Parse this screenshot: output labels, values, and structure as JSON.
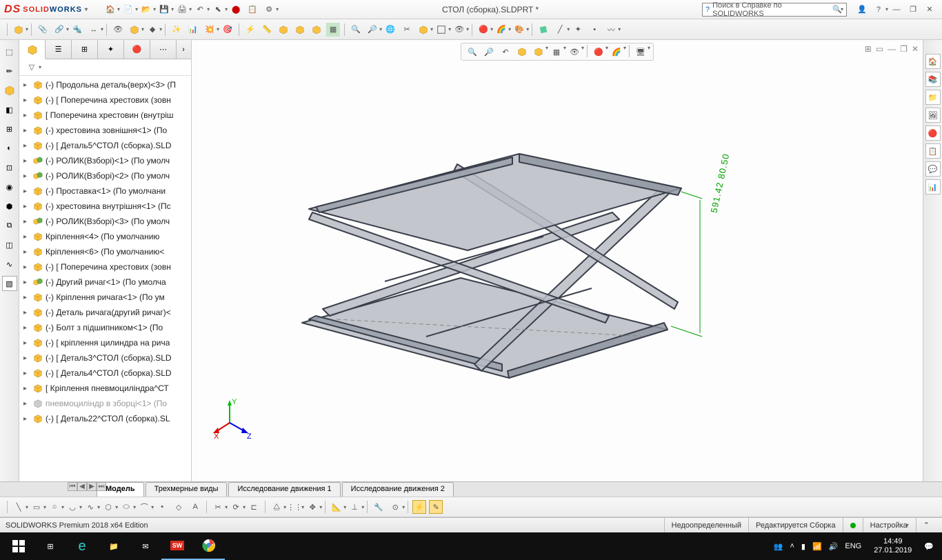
{
  "logo": {
    "solid": "SOLID",
    "works": "WORKS"
  },
  "doc_title": "СТОЛ (сборка).SLDPRT *",
  "search_placeholder": "Поиск в Справке по SOLIDWORKS",
  "dim_value": "591.42 80.50",
  "tree": [
    {
      "icon": "part",
      "label": "(-) Продольна деталь(верх)<3> (П"
    },
    {
      "icon": "part",
      "label": "(-) [ Поперечина хрестових (зовн"
    },
    {
      "icon": "part",
      "label": "[ Поперечина хрестовин (внутріш"
    },
    {
      "icon": "part",
      "label": "(-) хрестовина зовнішня<1> (По "
    },
    {
      "icon": "part",
      "label": "(-) [ Деталь5^СТОЛ (сборка).SLD"
    },
    {
      "icon": "asm",
      "label": "(-) РОЛИК(Взборі)<1> (По умолч"
    },
    {
      "icon": "asm",
      "label": "(-) РОЛИК(Взборі)<2> (По умолч"
    },
    {
      "icon": "part",
      "label": "(-) Проставка<1> (По умолчани"
    },
    {
      "icon": "part",
      "label": "(-) хрестовина внутрішня<1> (Пс"
    },
    {
      "icon": "asm",
      "label": "(-) РОЛИК(Взборі)<3> (По умолч"
    },
    {
      "icon": "part",
      "label": "Кріплення<4> (По умолчанию"
    },
    {
      "icon": "part",
      "label": "Кріплення<6> (По умолчанию<"
    },
    {
      "icon": "part",
      "label": "(-) [ Поперечина хрестових (зовн"
    },
    {
      "icon": "asm",
      "label": "(-) Другий ричаг<1> (По умолча"
    },
    {
      "icon": "part",
      "label": "(-) Кріплення ричага<1> (По ум"
    },
    {
      "icon": "part",
      "label": "(-) Деталь ричага(другий ричаг)<"
    },
    {
      "icon": "part",
      "label": "(-) Болт з підшипником<1> (По "
    },
    {
      "icon": "part",
      "label": "(-) [ кріплення цилиндра на рича"
    },
    {
      "icon": "part",
      "label": "(-) [ Деталь3^СТОЛ (сборка).SLD"
    },
    {
      "icon": "part",
      "label": "(-) [ Деталь4^СТОЛ (сборка).SLD"
    },
    {
      "icon": "part",
      "label": "[ Кріплення пневмоцилiндра^СТ"
    },
    {
      "icon": "sup",
      "label": "пневмоцилiндр в зборці<1> (По"
    },
    {
      "icon": "part",
      "label": "(-) [ Деталь22^СТОЛ (сборка).SL"
    }
  ],
  "bottom_tabs": {
    "model": "Модель",
    "views3d": "Трехмерные виды",
    "motion1": "Исследование движения 1",
    "motion2": "Исследование движения 2"
  },
  "status": {
    "edition": "SOLIDWORKS Premium 2018 x64 Edition",
    "under": "Недоопределенный",
    "editing": "Редактируется Сборка",
    "custom": "Настройка"
  },
  "tray": {
    "lang": "ENG",
    "time": "14:49",
    "date": "27.01.2019"
  }
}
